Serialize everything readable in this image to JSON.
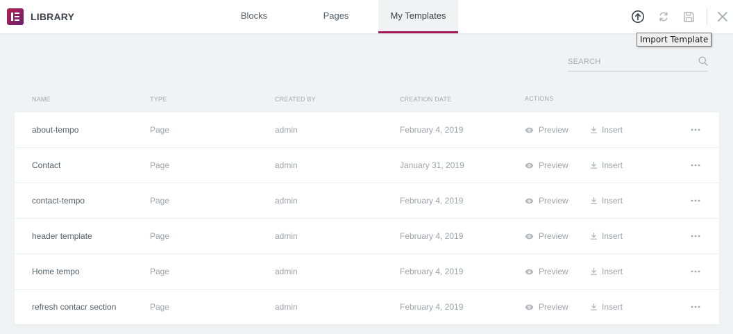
{
  "header": {
    "title": "LIBRARY",
    "logo_icon": "elementor-logo-icon",
    "tabs": [
      {
        "label": "Blocks",
        "active": false
      },
      {
        "label": "Pages",
        "active": false
      },
      {
        "label": "My Templates",
        "active": true
      }
    ],
    "icons": [
      "import-template-icon",
      "sync-icon",
      "save-icon",
      "close-icon"
    ],
    "tooltip": "Import Template",
    "accent_color": "#a4185a"
  },
  "search": {
    "placeholder": "SEARCH",
    "value": ""
  },
  "table": {
    "columns": [
      "NAME",
      "TYPE",
      "CREATED BY",
      "CREATION DATE",
      "ACTIONS"
    ],
    "action_labels": {
      "preview": "Preview",
      "insert": "Insert"
    },
    "rows": [
      {
        "name": "about-tempo",
        "type": "Page",
        "created_by": "admin",
        "date": "February 4, 2019"
      },
      {
        "name": "Contact",
        "type": "Page",
        "created_by": "admin",
        "date": "January 31, 2019"
      },
      {
        "name": "contact-tempo",
        "type": "Page",
        "created_by": "admin",
        "date": "February 4, 2019"
      },
      {
        "name": "header template",
        "type": "Page",
        "created_by": "admin",
        "date": "February 4, 2019"
      },
      {
        "name": "Home tempo",
        "type": "Page",
        "created_by": "admin",
        "date": "February 4, 2019"
      },
      {
        "name": "refresh contacr section",
        "type": "Page",
        "created_by": "admin",
        "date": "February 4, 2019"
      }
    ]
  }
}
